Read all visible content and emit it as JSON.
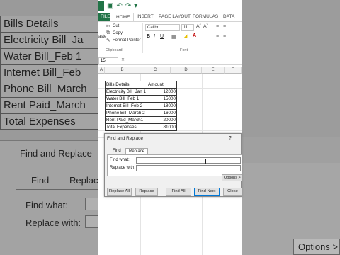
{
  "background": {
    "zoom_rows": [
      "Bills Details",
      "Electricity Bill_Ja",
      "Water Bill_Feb 1",
      "Internet Bill_Feb",
      "Phone Bill_March",
      "Rent Paid_March",
      "Total Expenses"
    ],
    "dialog_title": "Find and Replace",
    "tab_find": "Find",
    "tab_replace": "Replac",
    "find_what_label": "Find what:",
    "replace_with_label": "Replace with:",
    "options_button": "Options >"
  },
  "window": {
    "tabs": {
      "file": "FILE",
      "home": "HOME",
      "insert": "INSERT",
      "page_layout": "PAGE LAYOUT",
      "formulas": "FORMULAS",
      "data": "DATA"
    },
    "clipboard": {
      "cut": "Cut",
      "copy": "Copy",
      "format_painter": "Format Painter",
      "paste": "aste",
      "group_label": "Clipboard"
    },
    "font": {
      "name": "Calibri",
      "size": "11",
      "group_label": "Font"
    },
    "namebox": "15",
    "columns": [
      "A",
      "B",
      "C",
      "D",
      "E",
      "F"
    ]
  },
  "table": {
    "header": {
      "label": "Bills Details",
      "amount": "Amount"
    },
    "rows": [
      {
        "label": "Electricity Bill_Jan 1",
        "amount": "12000"
      },
      {
        "label": "Water Bill_Feb 1",
        "amount": "15000"
      },
      {
        "label": "Internet Bill_Feb 2",
        "amount": "18000"
      },
      {
        "label": "Phone Bill_March 2",
        "amount": "16000"
      },
      {
        "label": "Rent Paid_March1",
        "amount": "20000"
      },
      {
        "label": "Total Expenses",
        "amount": "81000"
      }
    ]
  },
  "dialog": {
    "title": "Find and Replace",
    "help": "?",
    "tab_find": "Find",
    "tab_replace": "Replace",
    "find_what_label": "Find what:",
    "replace_with_label": "Replace with:",
    "find_what_value": "",
    "replace_with_value": "",
    "options_button": "Options >",
    "buttons": {
      "replace_all": "Replace All",
      "replace": "Replace",
      "find_all": "Find All",
      "find_next": "Find Next",
      "close": "Close"
    }
  }
}
